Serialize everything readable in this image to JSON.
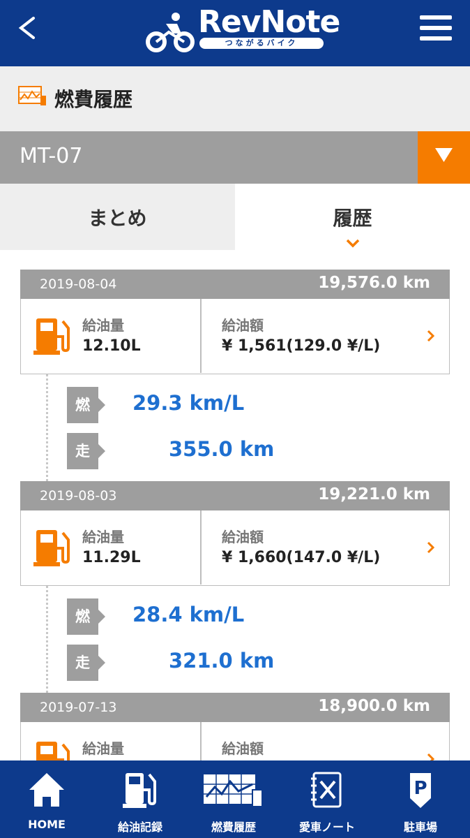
{
  "header": {
    "logo_text": "RevNote",
    "logo_tagline": "つながるバイク"
  },
  "section": {
    "title": "燃費履歴"
  },
  "vehicle": {
    "name": "MT-07"
  },
  "tabs": [
    {
      "label": "まとめ",
      "active": false
    },
    {
      "label": "履歴",
      "active": true
    }
  ],
  "records": [
    {
      "date": "2019-08-04",
      "odometer": "19,576.0 km",
      "qty_label": "給油量",
      "qty": "12.10L",
      "amount_label": "給油額",
      "amount": "¥ 1,561(129.0 ¥/L)",
      "fuel_economy_label": "燃費",
      "fuel_economy": "29.3 km/L",
      "distance_label": "走行距離",
      "distance": "355.0 km"
    },
    {
      "date": "2019-08-03",
      "odometer": "19,221.0 km",
      "qty_label": "給油量",
      "qty": "11.29L",
      "amount_label": "給油額",
      "amount": "¥ 1,660(147.0 ¥/L)",
      "fuel_economy_label": "燃費",
      "fuel_economy": "28.4 km/L",
      "distance_label": "走行距離",
      "distance": "321.0 km"
    },
    {
      "date": "2019-07-13",
      "odometer": "18,900.0 km",
      "qty_label": "給油量",
      "amount_label": "給油額"
    }
  ],
  "bottom_nav": [
    {
      "label": "HOME",
      "icon": "home-icon"
    },
    {
      "label": "給油記録",
      "icon": "fuel-pump-icon"
    },
    {
      "label": "燃費履歴",
      "icon": "fuel-history-icon"
    },
    {
      "label": "愛車ノート",
      "icon": "note-icon"
    },
    {
      "label": "駐車場",
      "icon": "parking-icon"
    }
  ],
  "colors": {
    "header_bg": "#0d3a8c",
    "accent": "#f57c00",
    "value_blue": "#1e6fd0",
    "tag_gray": "#9e9e9e"
  }
}
